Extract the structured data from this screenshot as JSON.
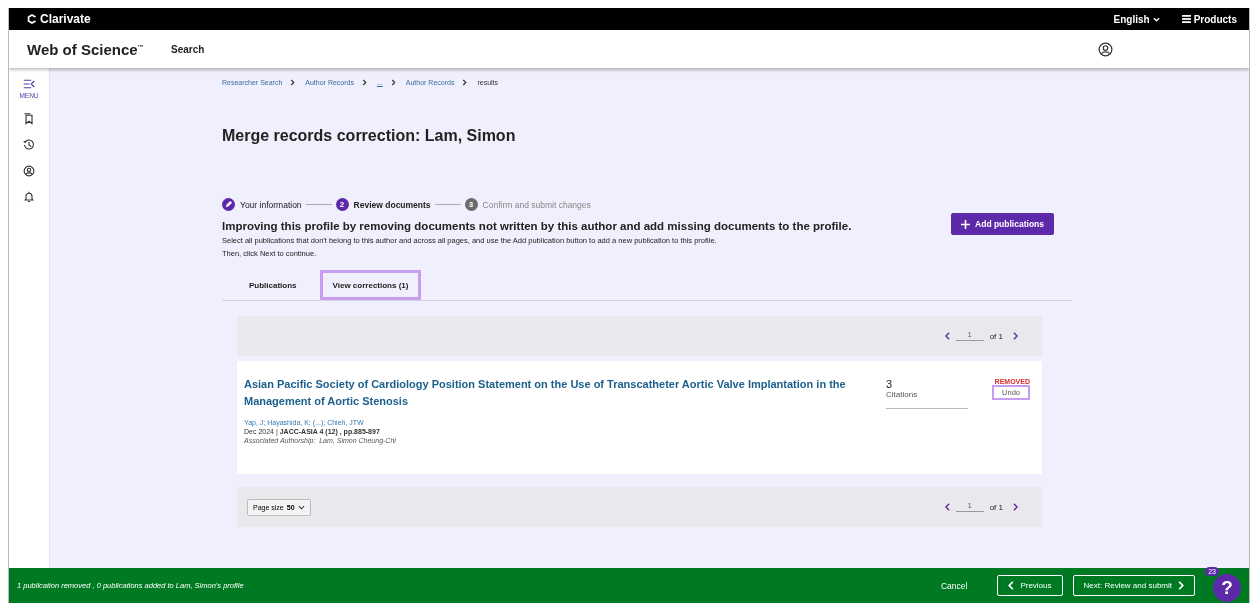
{
  "top_bar": {
    "brand": "Clarivate",
    "language": "English",
    "products": "Products"
  },
  "header": {
    "product": "Web of Science$^{™}$",
    "nav": "Search"
  },
  "sidebar": {
    "menu_label": "MENU"
  },
  "breadcrumb": [
    {
      "label": "Researcher Search",
      "kind": "link"
    },
    {
      "label": "Author Records",
      "kind": "link"
    },
    {
      "label": "...",
      "kind": "ellipsis"
    },
    {
      "label": "Author Records",
      "kind": "link"
    },
    {
      "label": "results",
      "kind": "current"
    }
  ],
  "title": "Merge records correction: Lam, Simon",
  "steps": [
    {
      "label": "Your information",
      "kind": "done"
    },
    {
      "label": "Review documents",
      "kind": "current",
      "number": "2"
    },
    {
      "label": "Confirm and submit changes",
      "kind": "upcoming",
      "number": "3"
    }
  ],
  "heading": "Improving this profile by removing documents not written by this author and add missing documents to the profile.",
  "instructions": [
    "Select all publications that don't belong to this author and across all pages, and use the Add publication button to add a new publication to this profile.",
    "Then, click Next to continue."
  ],
  "add_button": "Add publications",
  "tabs": [
    {
      "label": "Publications",
      "selected": false
    },
    {
      "label": "View corrections (1)",
      "selected": true
    }
  ],
  "pager_top": {
    "page": "1",
    "of": "of 1"
  },
  "record": {
    "title": "Asian Pacific Society of Cardiology Position Statement on the Use of Transcatheter Aortic Valve Implantation in the Management of Aortic Stenosis",
    "authors": "Yap, J; Hayashida, K; (...); Chieh, JTW",
    "publication": "Dec 2024 | **JACC-ASIA 4 (12) , pp.885-897**",
    "authorship": "Associated Authorship:  Lam, Simon Cheung-Chi",
    "citations": "3",
    "citations_label": "Citations",
    "status": "REMOVED",
    "undo": "Undo"
  },
  "pager_bottom": {
    "page_size_label": "Page size",
    "page_size": "50",
    "page": "1",
    "of": "of 1"
  },
  "footer": {
    "message": "1 publication removed , 0 publications added to Lam, Simon's profile",
    "cancel": "Cancel",
    "previous": "Previous",
    "next": "Next: Review and submit",
    "help_badge": "23",
    "help": "?"
  }
}
